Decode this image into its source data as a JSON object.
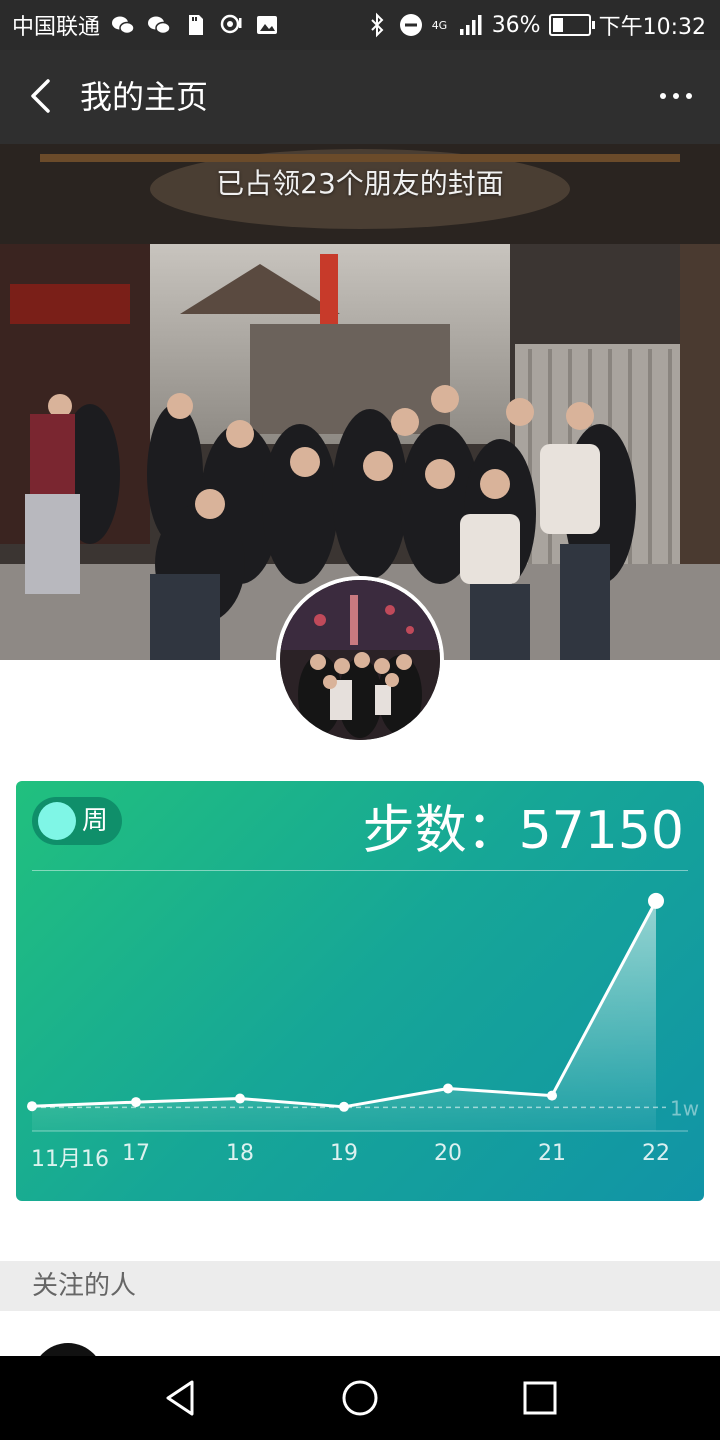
{
  "status_bar": {
    "carrier": "中国联通",
    "network": "4G",
    "battery": "36%",
    "battery_level": 0.36,
    "time": "下午10:32"
  },
  "header": {
    "title": "我的主页"
  },
  "cover": {
    "caption": "已占领23个朋友的封面"
  },
  "steps_card": {
    "toggle_label": "周",
    "steps_text": "步数：57150",
    "colors": {
      "start": "#21c07e",
      "end": "#1194a6"
    }
  },
  "chart_data": {
    "type": "area",
    "x": [
      "11月16",
      "17",
      "18",
      "19",
      "20",
      "21",
      "22"
    ],
    "values": [
      8200,
      8900,
      9500,
      8100,
      11200,
      10000,
      43000
    ],
    "reference_line": {
      "value": 8000,
      "label": "1w"
    },
    "ylim": [
      4000,
      44000
    ],
    "grid": false
  },
  "following": {
    "section_title": "关注的人"
  },
  "nav": {
    "back": "back-triangle-icon",
    "home": "home-circle-icon",
    "recents": "recents-square-icon"
  }
}
